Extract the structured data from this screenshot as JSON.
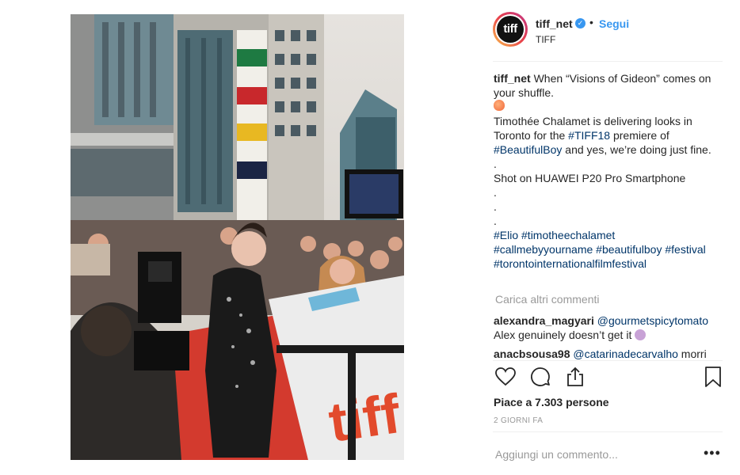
{
  "post": {
    "username": "tiff_net",
    "avatar_text": "tiff",
    "verified_icon": "verified-badge-icon",
    "separator": "•",
    "follow_label": "Segui",
    "subtitle": "TIFF"
  },
  "caption": {
    "username": "tiff_net",
    "line1": "When “Visions of Gideon” comes on",
    "line2": "your shuffle.",
    "line3_a": "Timothée Chalamet is delivering looks in",
    "line4_a": "Toronto for the ",
    "hashtag_tiff18": "#TIFF18",
    "line4_b": " premiere of",
    "hashtag_beautifulboy_cap": "#BeautifulBoy",
    "line5_b": " and yes, we’re doing just fine.",
    "dot": ".",
    "shot_on": "Shot on HUAWEI P20 Pro Smartphone",
    "hashtags_line1": "#Elio #timotheechalamet",
    "hashtags_line2": "#callmebyyourname #beautifulboy #festival",
    "hashtags_line3": "#torontointernationalfilmfestival"
  },
  "load_more": "Carica altri commenti",
  "comments": [
    {
      "user": "alexandra_magyari",
      "mention": "@gourmetspicytomato",
      "text": "Alex genuinely doesn’t get it"
    },
    {
      "user": "anacbsousa98",
      "mention": "@catarinadecarvalho",
      "text": "morri"
    }
  ],
  "likes": "Piace a 7.303 persone",
  "date": "2 GIORNI FA",
  "add_comment_placeholder": "Aggiungi un commento...",
  "more_options": "•••",
  "icons": [
    "heart-icon",
    "comment-icon",
    "share-icon",
    "bookmark-icon"
  ],
  "colors": {
    "accent": "#3897f0",
    "hashtag": "#003569",
    "muted": "#999999"
  }
}
